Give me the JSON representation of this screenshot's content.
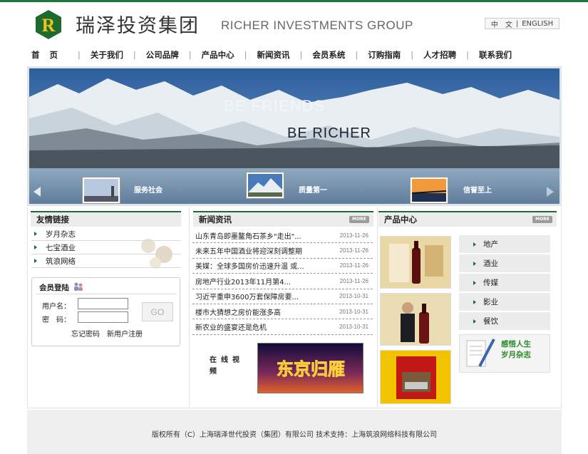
{
  "brand": {
    "name_cn": "瑞泽投资集团",
    "name_en": "RICHER INVESTMENTS GROUP",
    "accent": "#1a7a3a",
    "logo_letter": "R"
  },
  "lang": {
    "cn": "中　文",
    "sep": "|",
    "en": "ENGLISH"
  },
  "nav": {
    "items": [
      "首页",
      "关于我们",
      "公司品牌",
      "产品中心",
      "新闻资讯",
      "会员系统",
      "订购指南",
      "人才招聘",
      "联系我们"
    ],
    "separator": "|"
  },
  "banner": {
    "line1": "BE FRIENDS",
    "line2": "BE RICHER",
    "slides": [
      "服务社会",
      "质量第一",
      "信誉至上"
    ]
  },
  "friends": {
    "title": "友情链接",
    "links": [
      "岁月杂志",
      "七宝酒业",
      "筑浪网络"
    ]
  },
  "login": {
    "title": "会员登陆",
    "user_label": "用户名：",
    "pass_label": "密　码：",
    "go": "GO",
    "forgot": "忘记密码",
    "register": "新用户注册"
  },
  "news": {
    "title": "新闻资讯",
    "more": "MORE",
    "items": [
      {
        "title": "山东青岛即墨鳌角石茶乡\"走出\"...",
        "date": "2013-11-26"
      },
      {
        "title": "未来五年中国酒业将迎深刻调整期",
        "date": "2013-11-26"
      },
      {
        "title": "美媒：全球多国房价迅速升温 或...",
        "date": "2013-11-26"
      },
      {
        "title": "房地产行业2013年11月第4...",
        "date": "2013-11-26"
      },
      {
        "title": "习近平重申3600万套保障房要...",
        "date": "2013-10-31"
      },
      {
        "title": "楼市大猜想之房价能涨多高",
        "date": "2013-10-31"
      },
      {
        "title": "新农业的盛宴还是危机",
        "date": "2013-10-31"
      }
    ],
    "video_label": "在线视频",
    "video_caption": "东京归雁"
  },
  "products": {
    "title": "产品中心",
    "more": "MORE",
    "categories": [
      "地产",
      "酒业",
      "传媒",
      "影业",
      "餐饮"
    ],
    "magazine_line1": "感悟人生",
    "magazine_line2": "岁月杂志"
  },
  "footer": {
    "text": "版权所有（C）上海瑞泽世代投资（集团）有限公司 技术支持：上海筑浪网络科技有限公司"
  }
}
